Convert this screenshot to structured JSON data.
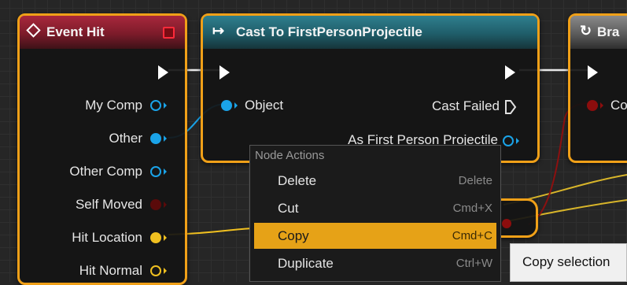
{
  "nodes": {
    "event_hit": {
      "title": "Event Hit",
      "pins": [
        {
          "label": "My Comp",
          "type": "object-ref"
        },
        {
          "label": "Other",
          "type": "object-ref-connected"
        },
        {
          "label": "Other Comp",
          "type": "object-ref"
        },
        {
          "label": "Self Moved",
          "type": "bool"
        },
        {
          "label": "Hit Location",
          "type": "vector-connected"
        },
        {
          "label": "Hit Normal",
          "type": "vector"
        }
      ]
    },
    "cast": {
      "title": "Cast To FirstPersonProjectile",
      "object_label": "Object",
      "cast_failed_label": "Cast Failed",
      "result_label": "As First Person Projectile"
    },
    "branch": {
      "title": "Bra",
      "condition_label": "Co"
    }
  },
  "context_menu": {
    "title": "Node Actions",
    "items": [
      {
        "label": "Delete",
        "shortcut": "Delete",
        "highlighted": false
      },
      {
        "label": "Cut",
        "shortcut": "Cmd+X",
        "highlighted": false
      },
      {
        "label": "Copy",
        "shortcut": "Cmd+C",
        "highlighted": true
      },
      {
        "label": "Duplicate",
        "shortcut": "Ctrl+W",
        "highlighted": false
      }
    ]
  },
  "tooltip": {
    "text": "Copy selection"
  },
  "colors": {
    "selection_outline": "#f0a018",
    "event_header": "#a9283c",
    "cast_header": "#2f7f8e",
    "object_pin": "#1aa3e8",
    "bool_pin": "#8c0d0d",
    "vector_pin": "#f0c020",
    "menu_highlight": "#e6a217"
  }
}
